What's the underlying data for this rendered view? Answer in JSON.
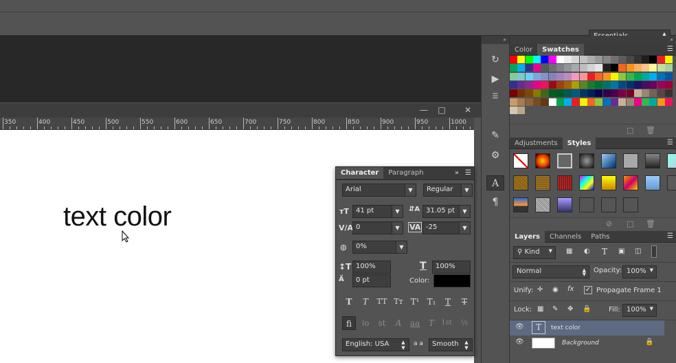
{
  "workspace": {
    "label": "Essentials"
  },
  "ruler": {
    "labels": [
      "350",
      "400",
      "450",
      "500",
      "550",
      "600",
      "650",
      "700",
      "750",
      "800",
      "850",
      "900",
      "950",
      "1000"
    ]
  },
  "canvas": {
    "text": "text color"
  },
  "dock": {
    "collapse": "»"
  },
  "color_panel": {
    "tabs": [
      "Color",
      "Swatches"
    ],
    "active": "Swatches"
  },
  "swatch_colors": [
    [
      "#ff0000",
      "#ffff00",
      "#00ff00",
      "#00ffff",
      "#0000ff",
      "#ff00ff",
      "#ffffff",
      "#ebebeb",
      "#d6d6d6",
      "#c2c2c2",
      "#adadad",
      "#999999",
      "#858585",
      "#707070",
      "#5c5c5c",
      "#474747",
      "#333333",
      "#1f1f1f",
      "#000000",
      "#ed1c24",
      "#fff200"
    ],
    [
      "#00a651",
      "#00aeef",
      "#2e3192",
      "#ec008c",
      "#58595b",
      "#6d6e71",
      "#808285",
      "#939598",
      "#a7a9ac",
      "#bcbec0",
      "#d1d3d4",
      "#e6e7e8",
      "#231f20",
      "#000000",
      "#f26522",
      "#f7941d",
      "#fbaf5d",
      "#fdc689",
      "#fff799",
      "#c4df9b",
      "#a3d39c"
    ],
    [
      "#82ca9c",
      "#7accc8",
      "#6dcff6",
      "#7da7d9",
      "#8393ca",
      "#8781bd",
      "#a186be",
      "#bd8cbf",
      "#f49ac1",
      "#f5989d",
      "#ed1c24",
      "#f26522",
      "#f7941d",
      "#fff200",
      "#8dc63f",
      "#39b54a",
      "#00a651",
      "#00a99d",
      "#00aeef",
      "#0072bc",
      "#0054a6"
    ],
    [
      "#2e3192",
      "#662d91",
      "#92278f",
      "#ec008c",
      "#ed145b",
      "#9e0b0f",
      "#a0410d",
      "#a36209",
      "#aba000",
      "#598527",
      "#197b30",
      "#007236",
      "#00746b",
      "#0076a3",
      "#004a80",
      "#003471",
      "#1b1464",
      "#440e62",
      "#630460",
      "#9e005d",
      "#9e0039"
    ],
    [
      "#790000",
      "#7b2e00",
      "#7d4900",
      "#827b00",
      "#406618",
      "#005e20",
      "#005826",
      "#005952",
      "#005b7f",
      "#003663",
      "#002157",
      "#0d004c",
      "#32004b",
      "#4b0049",
      "#7b0046",
      "#7a0026",
      "#c7b299",
      "#998675",
      "#736357",
      "#534741",
      "#37302d"
    ],
    [
      "#c69c6d",
      "#a67c52",
      "#8c6239",
      "#754c24",
      "#603913",
      "#ffffff",
      "#00a651",
      "#00aeef",
      "#ed1c24",
      "#fff200",
      "#f26522",
      "#8dc63f",
      "#0072bc",
      "#662d91",
      "#c7b299",
      "#998675",
      "#ec008c",
      "#39b54a",
      "#00a99d",
      "#f7941d",
      "#ed145b"
    ],
    [
      "#d4c8b0",
      "#b8a888"
    ]
  ],
  "adjustments_panel": {
    "tabs": [
      "Adjustments",
      "Styles"
    ],
    "active": "Styles"
  },
  "layers_panel": {
    "tabs": [
      "Layers",
      "Channels",
      "Paths"
    ],
    "active": "Layers",
    "filter_kind": "Kind",
    "blend_mode": "Normal",
    "opacity_label": "Opacity:",
    "opacity_value": "100%",
    "unify_label": "Unify:",
    "propagate_label": "Propagate Frame 1",
    "lock_label": "Lock:",
    "fill_label": "Fill:",
    "fill_value": "100%",
    "layers": [
      {
        "name": "text color",
        "thumb": "T",
        "selected": true
      },
      {
        "name": "Background",
        "thumb": "",
        "selected": false
      }
    ]
  },
  "character_panel": {
    "tabs": [
      "Character",
      "Paragraph"
    ],
    "active": "Character",
    "font_family": "Arial",
    "font_style": "Regular",
    "font_size": "41 pt",
    "leading": "31.05 pt",
    "kerning": "0",
    "tracking": "-25",
    "tsume": "0%",
    "vertical_scale": "100%",
    "horizontal_scale": "100%",
    "baseline_shift": "0 pt",
    "color_label": "Color:",
    "color_value": "#000000",
    "language": "English: USA",
    "antialias": "Smooth",
    "aa_label": "a a"
  }
}
